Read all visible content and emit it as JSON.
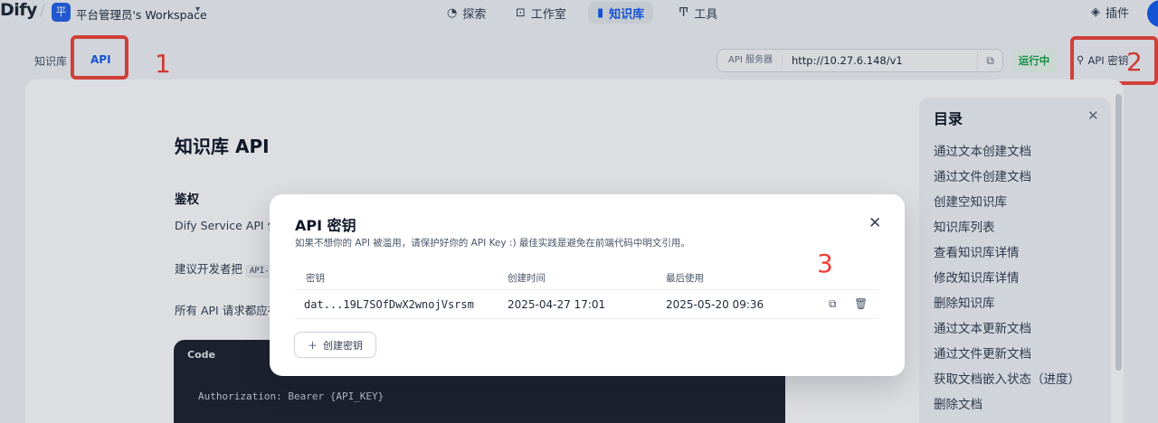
{
  "app": {
    "logo": "Dify",
    "workspace_initial": "平",
    "workspace_name": "平台管理员's Workspace"
  },
  "nav": {
    "items": [
      {
        "label": "探索",
        "icon": "explore-icon"
      },
      {
        "label": "工作室",
        "icon": "robot-icon"
      },
      {
        "label": "知识库",
        "icon": "book-icon",
        "active": true
      },
      {
        "label": "工具",
        "icon": "tools-icon"
      }
    ],
    "plugins_label": "插件"
  },
  "subheader": {
    "tabs": [
      {
        "label": "知识库"
      },
      {
        "label": "API",
        "active": true
      }
    ],
    "server_label": "API 服务器",
    "server_url": "http://10.27.6.148/v1",
    "status": "运行中",
    "api_key_button": "API 密钥"
  },
  "annotations": [
    "1",
    "2",
    "3"
  ],
  "doc": {
    "title": "知识库 API",
    "section": "鉴权",
    "p1": "Dify Service API 使",
    "p2_prefix": "建议开发者把",
    "p2_code": "API-K",
    "p3": "所有 API 请求都应在",
    "code_header": "Code",
    "code_line": "Authorization: Bearer {API_KEY}"
  },
  "toc": {
    "title": "目录",
    "items": [
      "通过文本创建文档",
      "通过文件创建文档",
      "创建空知识库",
      "知识库列表",
      "查看知识库详情",
      "修改知识库详情",
      "删除知识库",
      "通过文本更新文档",
      "通过文件更新文档",
      "获取文档嵌入状态（进度）",
      "删除文档"
    ]
  },
  "modal": {
    "title": "API 密钥",
    "description": "如果不想你的 API 被滥用，请保护好你的 API Key :) 最佳实践是避免在前端代码中明文引用。",
    "columns": [
      "密钥",
      "创建时间",
      "最后使用"
    ],
    "rows": [
      {
        "key": "dat...19L7SOfDwX2wnojVsrsm",
        "created": "2025-04-27 17:01",
        "last_used": "2025-05-20 09:36"
      }
    ],
    "create_button": "创建密钥"
  },
  "colors": {
    "accent": "#155eef",
    "annotation_red": "#f0453b",
    "status_green": "#16a34a"
  }
}
